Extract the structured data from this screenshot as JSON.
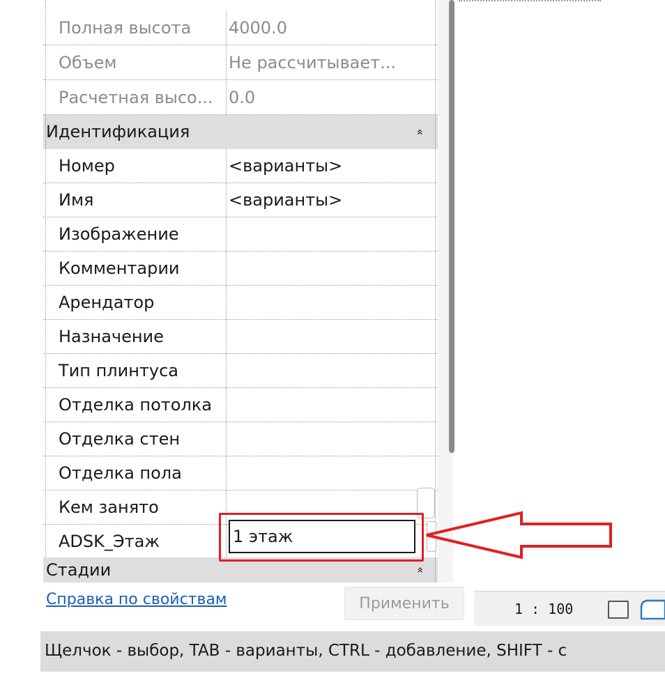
{
  "properties": {
    "rows": [
      {
        "name": "Полная высота",
        "value": "4000.0",
        "kind": "readonly"
      },
      {
        "name": "Объем",
        "value": "Не рассчитывает...",
        "kind": "readonly"
      },
      {
        "name": "Расчетная высо...",
        "value": "0.0",
        "kind": "readonly"
      },
      {
        "name": "Идентификация",
        "value": "",
        "kind": "group",
        "collapse_glyph": "«"
      },
      {
        "name": "Номер",
        "value": "<варианты>",
        "kind": "param"
      },
      {
        "name": "Имя",
        "value": "<варианты>",
        "kind": "param"
      },
      {
        "name": "Изображение",
        "value": "",
        "kind": "param"
      },
      {
        "name": "Комментарии",
        "value": "",
        "kind": "param"
      },
      {
        "name": "Арендатор",
        "value": "",
        "kind": "param"
      },
      {
        "name": "Назначение",
        "value": "",
        "kind": "param"
      },
      {
        "name": "Тип плинтуса",
        "value": "",
        "kind": "param"
      },
      {
        "name": "Отделка потолка",
        "value": "",
        "kind": "param"
      },
      {
        "name": "Отделка стен",
        "value": "",
        "kind": "param"
      },
      {
        "name": "Отделка пола",
        "value": "",
        "kind": "param"
      },
      {
        "name": "Кем занято",
        "value": "",
        "kind": "param"
      },
      {
        "name": "ADSK_Этаж",
        "value": "",
        "kind": "param-editing"
      },
      {
        "name": "Стадии",
        "value": "",
        "kind": "group",
        "collapse_glyph": "«"
      }
    ],
    "editing_value": "1 этаж"
  },
  "footer": {
    "help_link": "Справка по свойствам",
    "apply_label": "Применить"
  },
  "viewbar": {
    "scale": "1 : 100",
    "icons": [
      "detail-level-icon",
      "visual-style-icon"
    ]
  },
  "statusbar": {
    "text": "Щелчок - выбор, TAB - варианты, CTRL - добавление, SHIFT - с"
  },
  "colors": {
    "annotation_red": "#e02020",
    "link_blue": "#1a5fb4",
    "group_header_bg": "#dedede",
    "statusbar_bg": "#dcdcdc"
  }
}
